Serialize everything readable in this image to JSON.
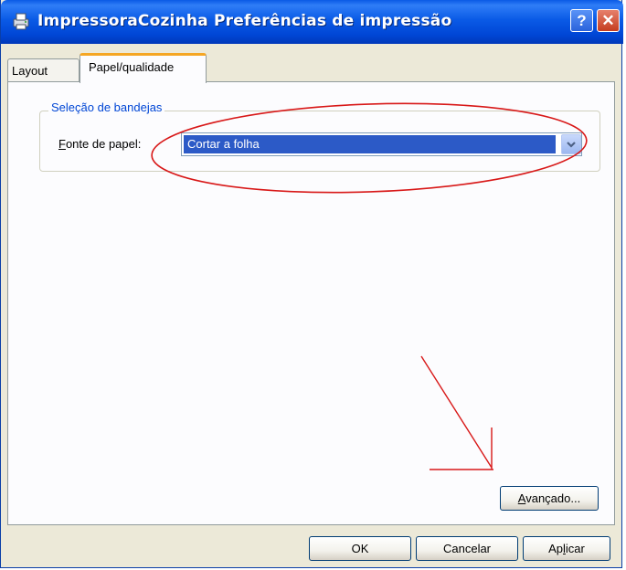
{
  "window": {
    "title": "ImpressoraCozinha Preferências de impressão",
    "help_label": "?",
    "close_label": "✕"
  },
  "tabs": [
    {
      "label": "Layout",
      "selected": false
    },
    {
      "label": "Papel/qualidade",
      "selected": true
    }
  ],
  "tray_selection": {
    "group_label": "Seleção de bandejas",
    "paper_source_label_mnemonic": "F",
    "paper_source_label_rest": "onte de papel:",
    "paper_source_value": "Cortar a folha"
  },
  "buttons": {
    "advanced_mnemonic": "A",
    "advanced_rest": "vançado...",
    "ok": "OK",
    "cancel": "Cancelar",
    "apply_pre": "Ap",
    "apply_mnemonic": "l",
    "apply_rest": "icar"
  },
  "colors": {
    "title_bar": "#0a5ae6",
    "annotation": "#d81818",
    "selection": "#2c5ac7"
  }
}
